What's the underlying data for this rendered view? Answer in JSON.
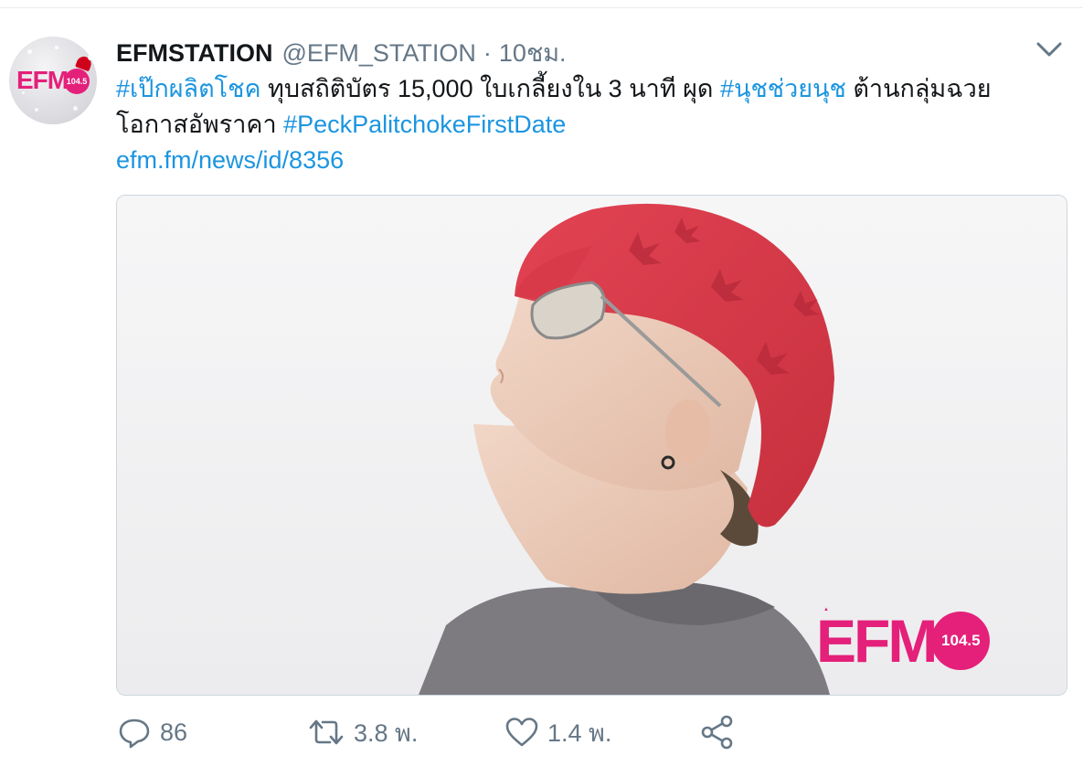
{
  "tweet": {
    "display_name": "EFMSTATION",
    "handle": "@EFM_STATION",
    "separator": "·",
    "time": "10ชม.",
    "body": {
      "line1": [
        {
          "text": "#เป๊กผลิตโชค",
          "link": true
        },
        {
          "text": " ทุบสถิติบัตร 15,000 ใบเกลี้ยงใน 3 นาที ผุด ",
          "link": false
        },
        {
          "text": "#นุชช่วยนุช",
          "link": true
        },
        {
          "text": " ต้านกลุ่มฉวย",
          "link": false
        }
      ],
      "line2": [
        {
          "text": "โอกาสอัพราคา ",
          "link": false
        },
        {
          "text": "#PeckPalitchokeFirstDate",
          "link": true
        }
      ],
      "url": "efm.fm/news/id/8356"
    },
    "avatar": {
      "logo_text": "EFM",
      "logo_badge": "104.5"
    },
    "media": {
      "watermark_text": "EFM",
      "watermark_badge": "104.5"
    },
    "actions": {
      "reply": {
        "icon": "reply-icon",
        "count": "86"
      },
      "retweet": {
        "icon": "retweet-icon",
        "count": "3.8 พ."
      },
      "like": {
        "icon": "heart-icon",
        "count": "1.4 พ."
      },
      "share": {
        "icon": "share-icon"
      }
    }
  },
  "colors": {
    "link": "#1b95e0",
    "muted": "#657786",
    "text": "#14171a",
    "brand": "#e4207a"
  }
}
